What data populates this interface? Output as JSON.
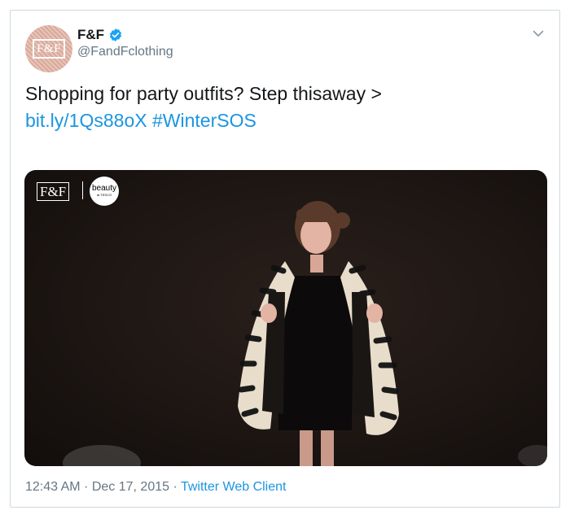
{
  "account": {
    "display_name": "F&F",
    "handle": "@FandFclothing",
    "avatar_text": "F&F",
    "verified": true
  },
  "tweet": {
    "text": "Shopping for party outfits? Step thisaway >",
    "link": "bit.ly/1Qs88oX",
    "hashtag": "#WinterSOS"
  },
  "media": {
    "brand_badge": "F&F",
    "beauty_badge": "beauty",
    "beauty_badge_sub": "at TESCO"
  },
  "footer": {
    "time": "12:43 AM",
    "separator1": " · ",
    "date": "Dec 17, 2015",
    "separator2": " · ",
    "source": "Twitter Web Client"
  },
  "colors": {
    "link": "#1b95e0",
    "verified": "#1da1f2",
    "muted": "#657786"
  },
  "icons": [
    "verified-badge-icon",
    "chevron-down-icon"
  ]
}
